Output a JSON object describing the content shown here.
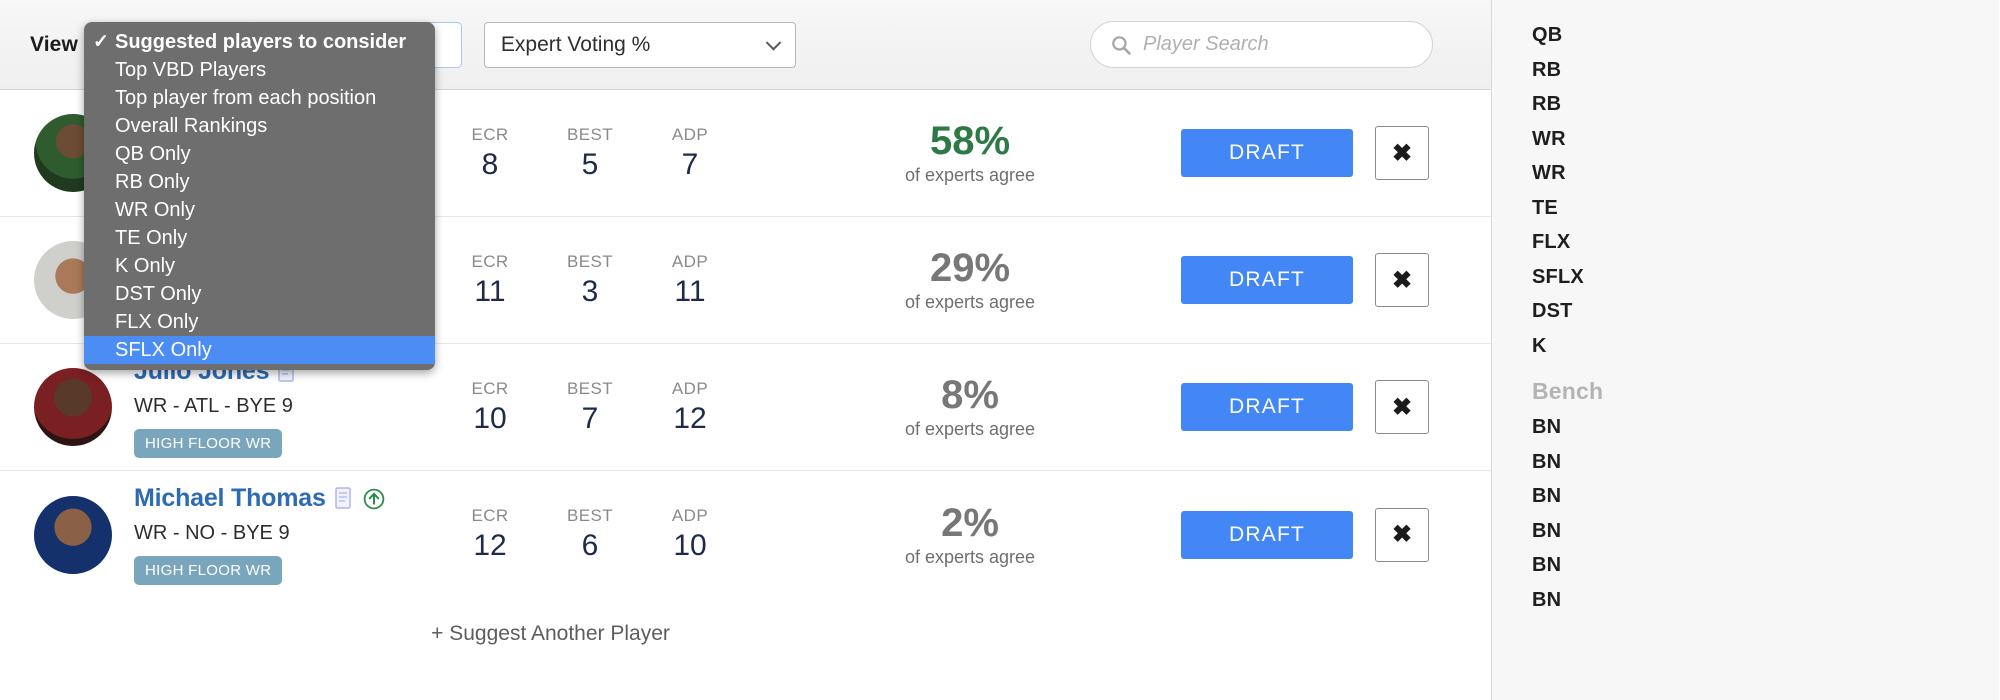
{
  "toolbar": {
    "view_label": "View",
    "view_select_value": "Suggested players to consider",
    "sort_select_value": "Expert Voting %",
    "search_placeholder": "Player Search",
    "search_value": ""
  },
  "dropdown": {
    "open": true,
    "items": [
      {
        "label": "Suggested players to consider",
        "checked": true,
        "highlighted": false
      },
      {
        "label": "Top VBD Players",
        "checked": false,
        "highlighted": false
      },
      {
        "label": "Top player from each position",
        "checked": false,
        "highlighted": false
      },
      {
        "label": "Overall Rankings",
        "checked": false,
        "highlighted": false
      },
      {
        "label": "QB Only",
        "checked": false,
        "highlighted": false
      },
      {
        "label": "RB Only",
        "checked": false,
        "highlighted": false
      },
      {
        "label": "WR Only",
        "checked": false,
        "highlighted": false
      },
      {
        "label": "TE Only",
        "checked": false,
        "highlighted": false
      },
      {
        "label": "K Only",
        "checked": false,
        "highlighted": false
      },
      {
        "label": "DST Only",
        "checked": false,
        "highlighted": false
      },
      {
        "label": "FLX Only",
        "checked": false,
        "highlighted": false
      },
      {
        "label": "SFLX Only",
        "checked": false,
        "highlighted": true
      }
    ]
  },
  "table": {
    "stat_labels": {
      "ecr": "ECR",
      "best": "BEST",
      "adp": "ADP"
    },
    "agree_suffix": "of experts agree",
    "draft_label": "DRAFT",
    "remove_label": "✖",
    "suggest_label": "+ Suggest Another Player",
    "rows": [
      {
        "name": "",
        "meta": "",
        "badge": "",
        "ecr": "8",
        "best": "5",
        "adp": "7",
        "agree": "58%",
        "agree_green": true,
        "has_note": false,
        "has_riser": false,
        "avatar_class": "av1",
        "obscured": true
      },
      {
        "name": "",
        "meta": "",
        "badge": "",
        "ecr": "11",
        "best": "3",
        "adp": "11",
        "agree": "29%",
        "agree_green": false,
        "has_note": false,
        "has_riser": false,
        "avatar_class": "av2",
        "obscured": true
      },
      {
        "name": "Julio Jones",
        "meta": "WR - ATL - BYE 9",
        "badge": "HIGH FLOOR WR",
        "ecr": "10",
        "best": "7",
        "adp": "12",
        "agree": "8%",
        "agree_green": false,
        "has_note": true,
        "has_riser": false,
        "avatar_class": "av3",
        "obscured": false
      },
      {
        "name": "Michael Thomas",
        "meta": "WR - NO - BYE 9",
        "badge": "HIGH FLOOR WR",
        "ecr": "12",
        "best": "6",
        "adp": "10",
        "agree": "2%",
        "agree_green": false,
        "has_note": true,
        "has_riser": true,
        "avatar_class": "av4",
        "obscured": false
      }
    ]
  },
  "roster": {
    "starters": [
      "QB",
      "RB",
      "RB",
      "WR",
      "WR",
      "TE",
      "FLX",
      "SFLX",
      "DST",
      "K"
    ],
    "bench_header": "Bench",
    "bench": [
      "BN",
      "BN",
      "BN",
      "BN",
      "BN",
      "BN"
    ]
  },
  "colors": {
    "accent_blue": "#4287f5",
    "link_blue": "#2d6bb5",
    "green": "#2d7a46",
    "badge_blue": "#7aa6bd",
    "menu_gray": "#6e6e6e",
    "menu_highlight": "#4c8cf5"
  }
}
